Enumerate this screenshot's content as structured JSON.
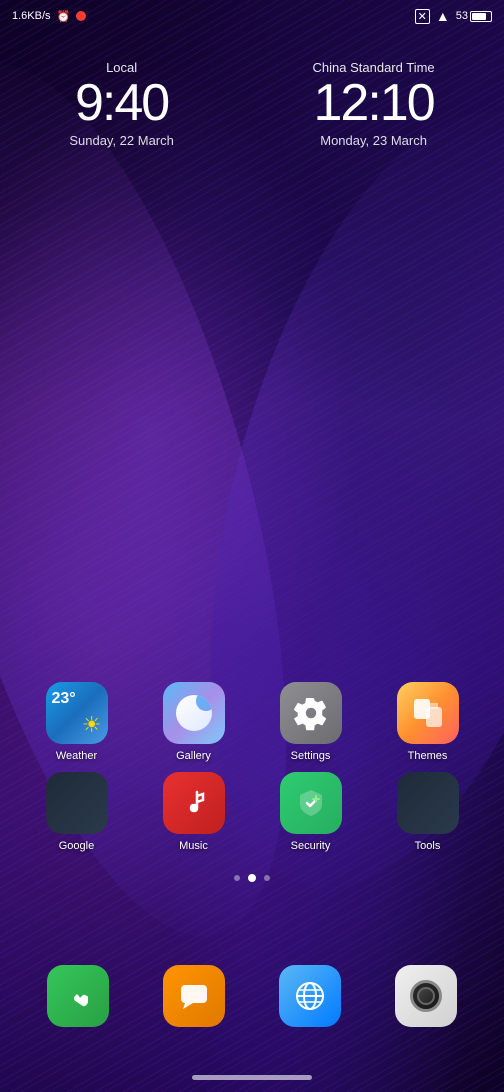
{
  "wallpaper": {
    "type": "abstract-swirl",
    "colors": [
      "#0a0520",
      "#2a0a6a",
      "#1a0540",
      "#4a1575"
    ]
  },
  "status_bar": {
    "speed": "1.6KB/s",
    "alarm_icon": "⏰",
    "signal_bars": "|||",
    "wifi": "wifi",
    "battery_percent": "53"
  },
  "dual_clock": {
    "local": {
      "label": "Local",
      "time": "9:40",
      "date": "Sunday, 22 March"
    },
    "china": {
      "label": "China Standard Time",
      "time": "12:10",
      "date": "Monday, 23 March"
    }
  },
  "app_rows": [
    {
      "apps": [
        {
          "id": "weather",
          "label": "Weather",
          "icon_type": "weather"
        },
        {
          "id": "gallery",
          "label": "Gallery",
          "icon_type": "gallery"
        },
        {
          "id": "settings",
          "label": "Settings",
          "icon_type": "settings"
        },
        {
          "id": "themes",
          "label": "Themes",
          "icon_type": "themes"
        }
      ]
    },
    {
      "apps": [
        {
          "id": "google",
          "label": "Google",
          "icon_type": "google"
        },
        {
          "id": "music",
          "label": "Music",
          "icon_type": "music"
        },
        {
          "id": "security",
          "label": "Security",
          "icon_type": "security"
        },
        {
          "id": "tools",
          "label": "Tools",
          "icon_type": "tools"
        }
      ]
    }
  ],
  "page_dots": [
    {
      "active": false
    },
    {
      "active": true
    },
    {
      "active": false
    }
  ],
  "dock": [
    {
      "id": "phone",
      "label": "Phone",
      "icon_type": "phone"
    },
    {
      "id": "messages",
      "label": "Messages",
      "icon_type": "messages"
    },
    {
      "id": "browser",
      "label": "Browser",
      "icon_type": "browser"
    },
    {
      "id": "camera",
      "label": "Camera",
      "icon_type": "camera"
    }
  ]
}
